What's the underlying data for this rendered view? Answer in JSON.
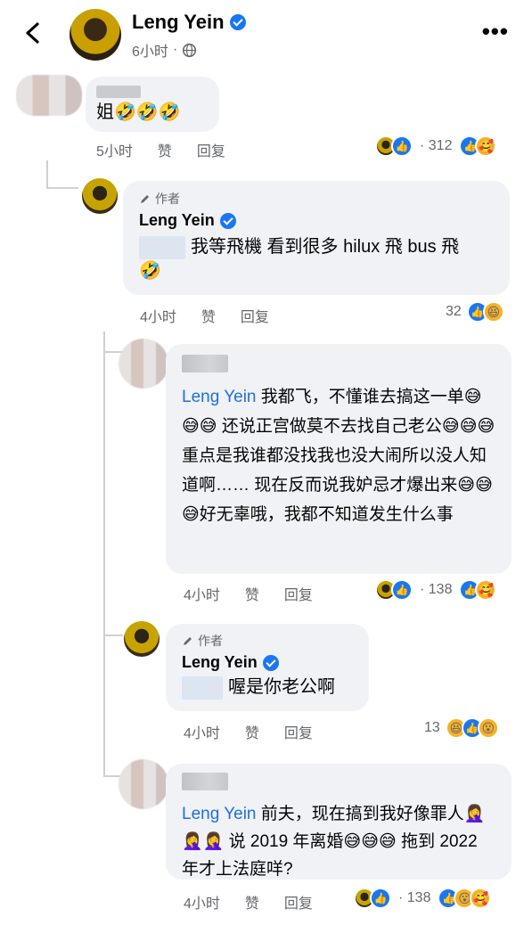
{
  "header": {
    "name": "Leng Yein",
    "time": "6小时",
    "separator": "·",
    "more": "•••"
  },
  "labels": {
    "like": "赞",
    "reply": "回复",
    "author": "作者"
  },
  "comments": [
    {
      "text": "姐🤣🤣🤣",
      "time": "5小时",
      "reaction_count": "· 312"
    },
    {
      "author": "Leng Yein",
      "text": "我等飛機 看到很多 hilux 飛 bus 飛",
      "emoji": "🤣",
      "time": "4小时",
      "reaction_count": "32"
    },
    {
      "mention": "Leng Yein",
      "text": " 我都飞，不懂谁去搞这一单😅😅😅 还说正宫做莫不去找自己老公😅😅😅 重点是我谁都没找我也没大闹所以没人知道啊…… 现在反而说我妒忌才爆出来😅😅😅好无辜哦，我都不知道发生什么事",
      "time": "4小时",
      "reaction_count": "· 138"
    },
    {
      "author": "Leng Yein",
      "text": "喔是你老公啊",
      "time": "4小时",
      "reaction_count": "13"
    },
    {
      "mention": "Leng Yein",
      "text": " 前夫，现在搞到我好像罪人🤦‍♀️🤦‍♀️🤦‍♀️ 说 2019 年离婚😅😅😅 拖到 2022 年才上法庭咩?",
      "time": "4小时",
      "reaction_count": "· 138"
    }
  ],
  "icons": {
    "back": "chevron-left-icon",
    "globe": "globe-icon",
    "verified": "verified-badge-icon",
    "pencil": "pencil-icon"
  },
  "colors": {
    "accent": "#1877f2",
    "mention": "#216fdb",
    "bubble": "#f0f2f5",
    "meta": "#65676b"
  }
}
